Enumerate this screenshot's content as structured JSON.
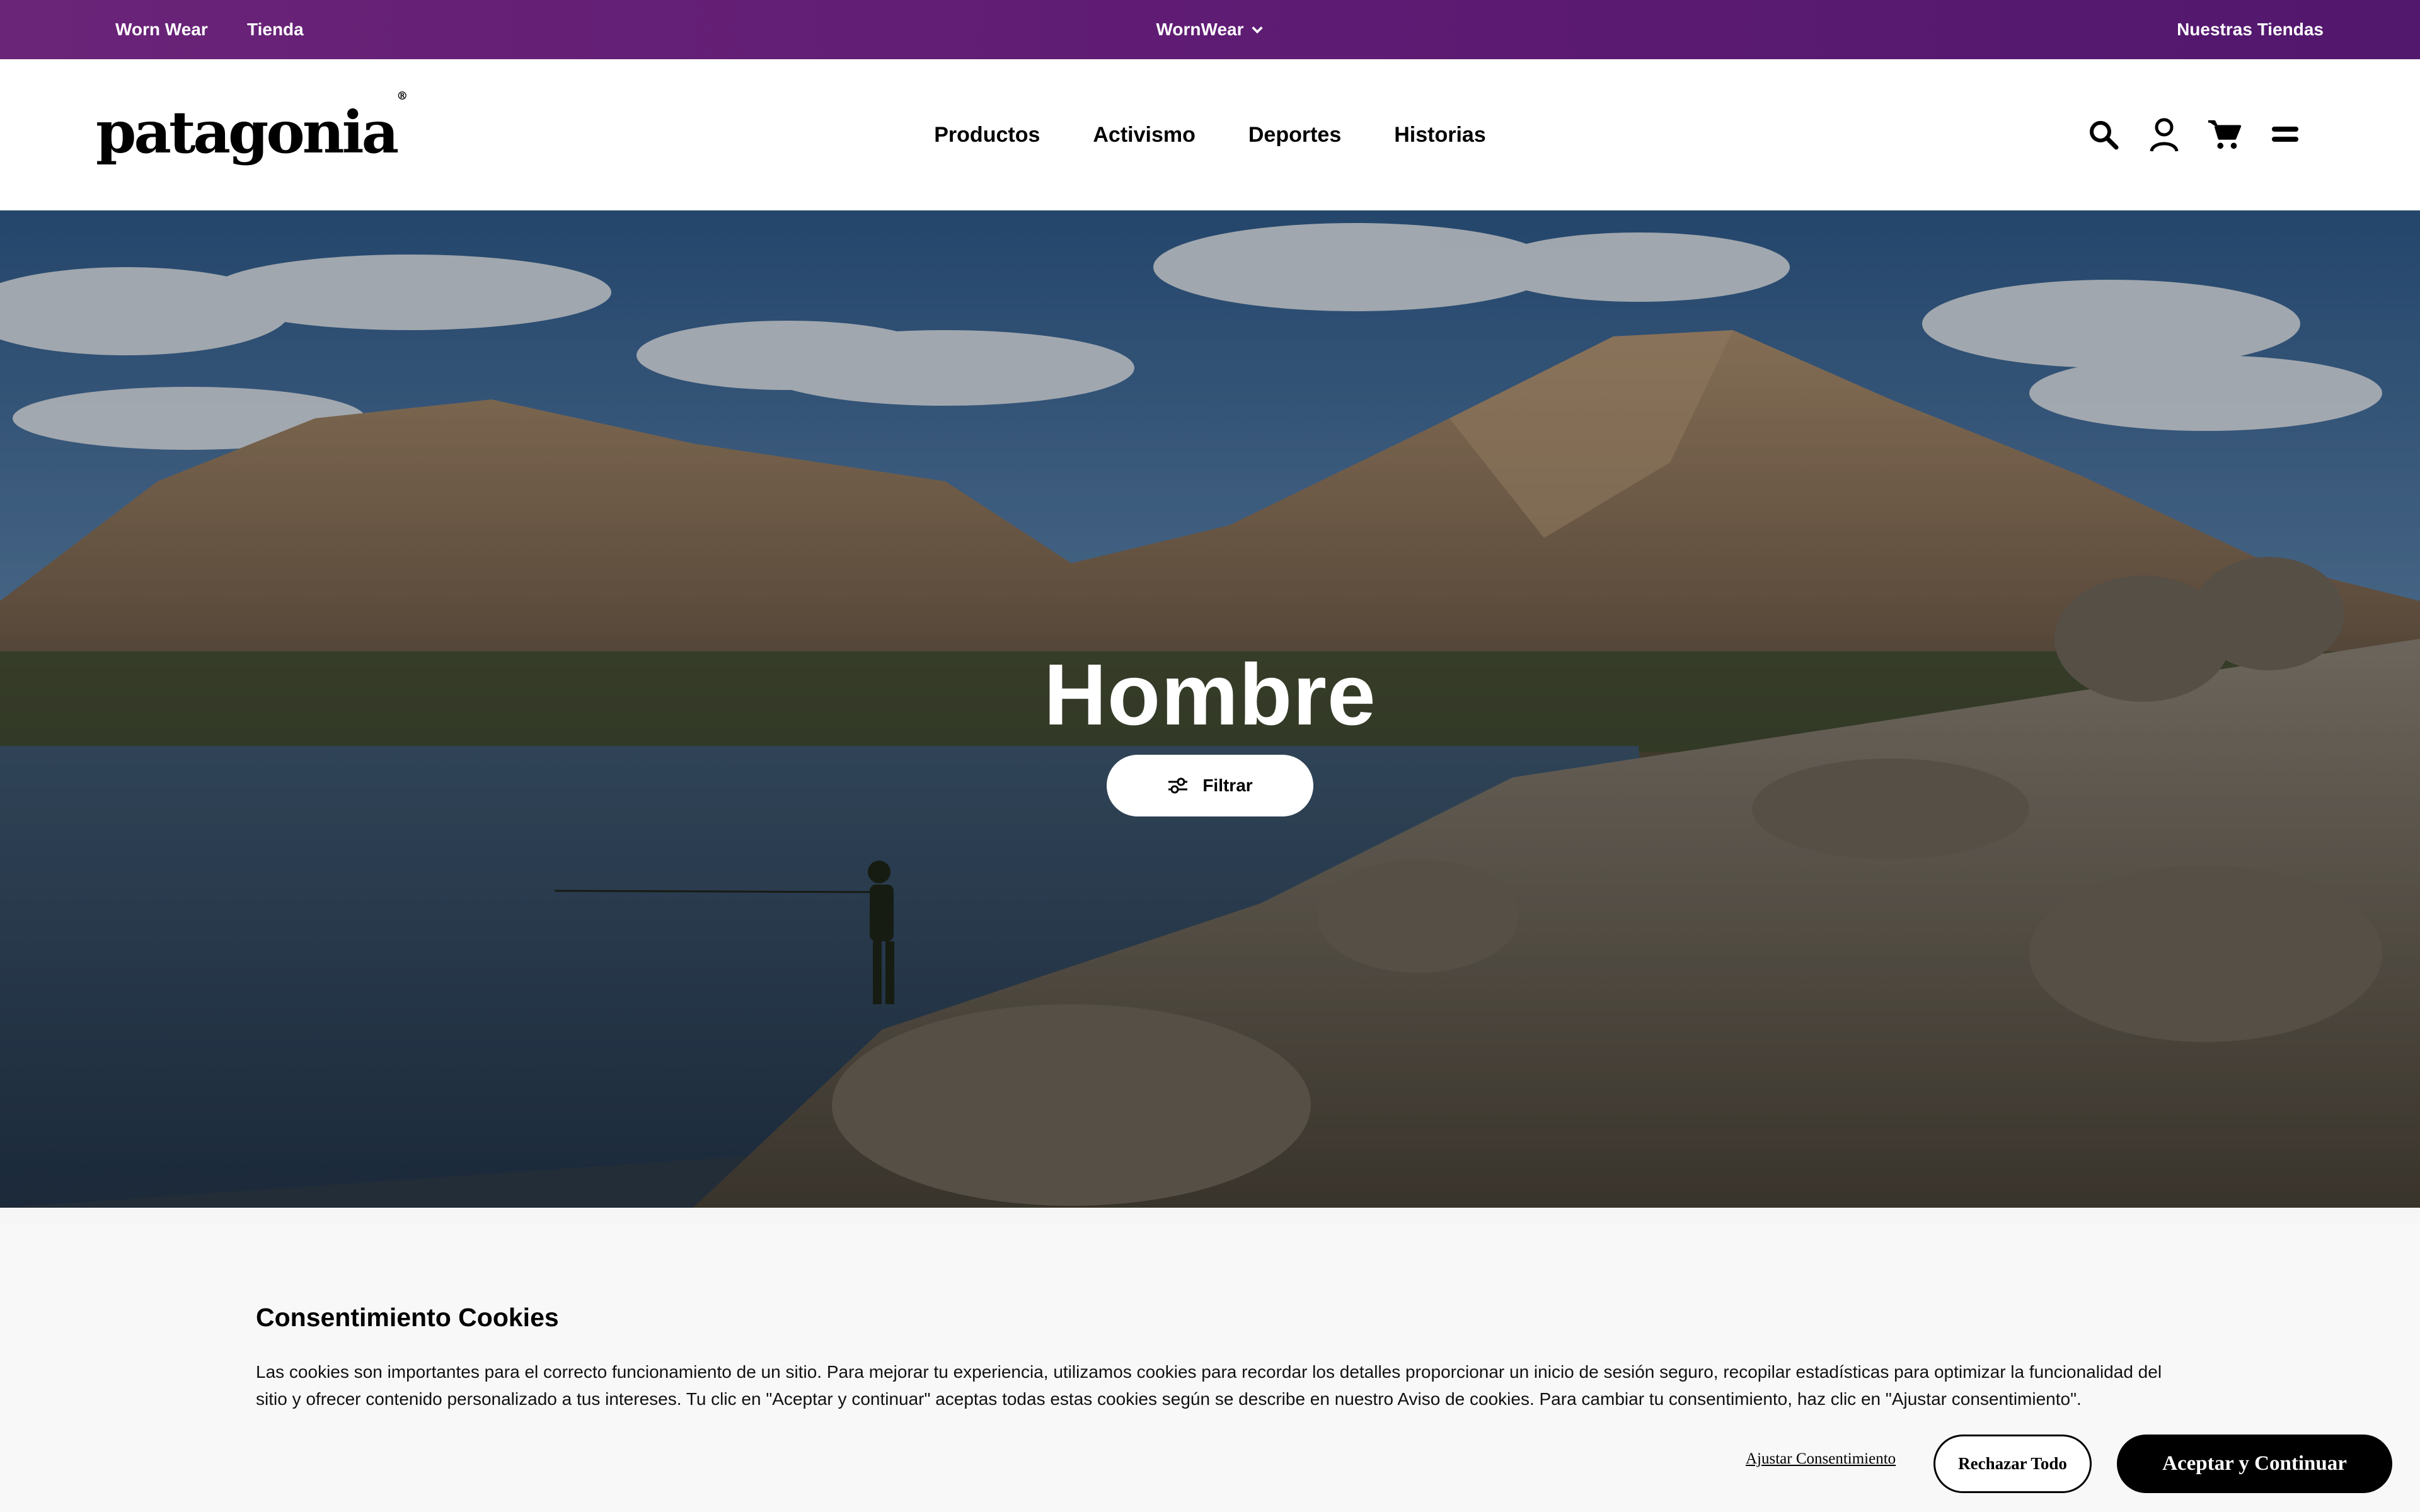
{
  "topbar": {
    "left_links": [
      "Worn Wear",
      "Tienda"
    ],
    "center_label": "WornWear",
    "right_label": "Nuestras Tiendas",
    "background": "#5e1b73"
  },
  "header": {
    "logo_text": "patagonia",
    "logo_mark": "®",
    "nav": [
      "Productos",
      "Activismo",
      "Deportes",
      "Historias"
    ],
    "icons": [
      "search-icon",
      "account-icon",
      "cart-icon",
      "menu-icon"
    ]
  },
  "hero": {
    "title": "Hombre",
    "filter_label": "Filtrar"
  },
  "cookie": {
    "title": "Consentimiento Cookies",
    "body": "Las cookies son importantes para el correcto funcionamiento de un sitio. Para mejorar tu experiencia, utilizamos cookies para recordar los detalles proporcionar un inicio de sesión seguro, recopilar estadísticas para optimizar la funcionalidad del sitio y ofrecer contenido personalizado a tus intereses. Tu clic en \"Aceptar y continuar\" aceptas todas estas cookies según se describe en nuestro Aviso de cookies. Para cambiar tu consentimiento, haz clic en \"Ajustar consentimiento\".",
    "adjust_label": "Ajustar Consentimiento",
    "reject_label": "Rechazar Todo",
    "accept_label": "Aceptar y Continuar"
  }
}
